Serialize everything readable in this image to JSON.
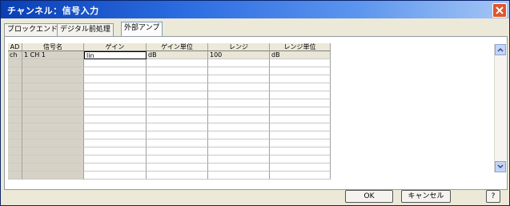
{
  "window": {
    "title": "チャンネル：信号入力",
    "close_icon": "close-icon",
    "accent": "#0a3fb5",
    "close_color": "#e0552c"
  },
  "tabs": [
    {
      "label": "ブロックエンド"
    },
    {
      "label": "デジタル前処理"
    },
    {
      "label": "外部アンプ",
      "active": true
    }
  ],
  "grid": {
    "headers": [
      "AD",
      "信号名",
      "ゲイン",
      "ゲイン単位",
      "レンジ",
      "レンジ単位"
    ],
    "rows": [
      {
        "ad": "ch",
        "name": "1 CH 1",
        "gain": "lin",
        "gain_unit": "dB",
        "range": "100",
        "range_unit": "dB"
      }
    ]
  },
  "buttons": {
    "ok": "OK",
    "cancel": "キャンセル",
    "help": "?"
  }
}
